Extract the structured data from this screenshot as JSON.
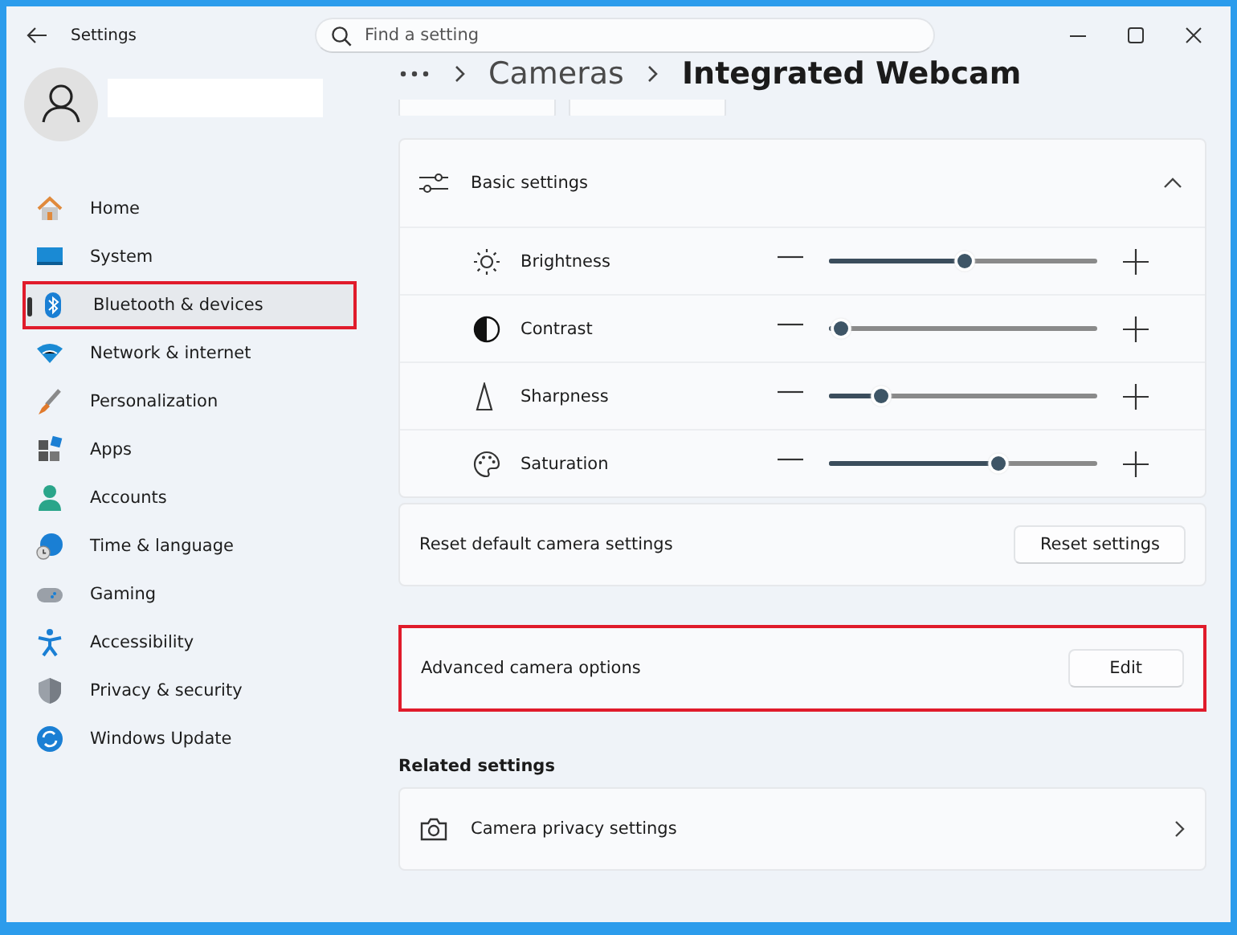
{
  "window": {
    "title": "Settings"
  },
  "search": {
    "placeholder": "Find a setting"
  },
  "breadcrumb": [
    "Cameras",
    "Integrated Webcam"
  ],
  "sidebar": {
    "items": [
      {
        "label": "Home",
        "selected": false,
        "highlighted": false
      },
      {
        "label": "System",
        "selected": false,
        "highlighted": false
      },
      {
        "label": "Bluetooth & devices",
        "selected": true,
        "highlighted": true
      },
      {
        "label": "Network & internet",
        "selected": false,
        "highlighted": false
      },
      {
        "label": "Personalization",
        "selected": false,
        "highlighted": false
      },
      {
        "label": "Apps",
        "selected": false,
        "highlighted": false
      },
      {
        "label": "Accounts",
        "selected": false,
        "highlighted": false
      },
      {
        "label": "Time & language",
        "selected": false,
        "highlighted": false
      },
      {
        "label": "Gaming",
        "selected": false,
        "highlighted": false
      },
      {
        "label": "Accessibility",
        "selected": false,
        "highlighted": false
      },
      {
        "label": "Privacy & security",
        "selected": false,
        "highlighted": false
      },
      {
        "label": "Windows Update",
        "selected": false,
        "highlighted": false
      }
    ]
  },
  "basic_settings": {
    "title": "Basic settings",
    "expanded": true,
    "sliders": [
      {
        "label": "Brightness",
        "level": 0.5
      },
      {
        "label": "Contrast",
        "level": 0.04
      },
      {
        "label": "Sharpness",
        "level": 0.19
      },
      {
        "label": "Saturation",
        "level": 0.63
      }
    ]
  },
  "reset": {
    "label": "Reset default camera settings",
    "button": "Reset settings"
  },
  "advanced": {
    "label": "Advanced camera options",
    "button": "Edit",
    "highlighted": true
  },
  "related_settings": {
    "heading": "Related settings",
    "items": [
      {
        "label": "Camera privacy settings"
      }
    ]
  }
}
